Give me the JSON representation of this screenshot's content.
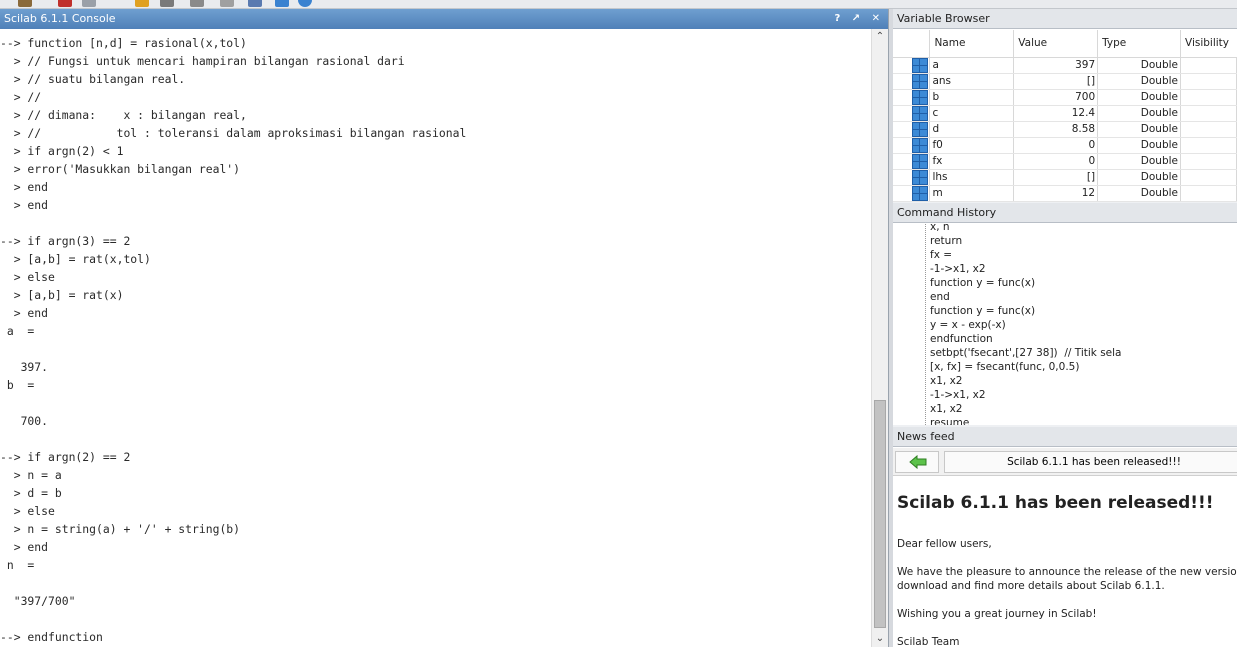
{
  "console": {
    "title": "Scilab 6.1.1 Console",
    "title_buttons": "? ↗ ✕",
    "lines": [
      "--> function [n,d] = rasional(x,tol)",
      "  > // Fungsi untuk mencari hampiran bilangan rasional dari",
      "  > // suatu bilangan real.",
      "  > //",
      "  > // dimana:    x : bilangan real,",
      "  > //           tol : toleransi dalam aproksimasi bilangan rasional",
      "  > if argn(2) < 1",
      "  > error('Masukkan bilangan real')",
      "  > end",
      "  > end",
      "",
      "--> if argn(3) == 2",
      "  > [a,b] = rat(x,tol)",
      "  > else",
      "  > [a,b] = rat(x)",
      "  > end",
      " a  =",
      "",
      "   397.",
      " b  =",
      "",
      "   700.",
      "",
      "--> if argn(2) == 2",
      "  > n = a",
      "  > d = b",
      "  > else",
      "  > n = string(a) + '/' + string(b)",
      "  > end",
      " n  =",
      "",
      "  \"397/700\"",
      "",
      "--> endfunction"
    ]
  },
  "variable_browser": {
    "title": "Variable Browser",
    "columns": [
      "Name",
      "Value",
      "Type",
      "Visibility"
    ],
    "rows": [
      {
        "name": "a",
        "value": "397",
        "type": "Double"
      },
      {
        "name": "ans",
        "value": "[]",
        "type": "Double"
      },
      {
        "name": "b",
        "value": "700",
        "type": "Double"
      },
      {
        "name": "c",
        "value": "12.4",
        "type": "Double"
      },
      {
        "name": "d",
        "value": "8.58",
        "type": "Double"
      },
      {
        "name": "f0",
        "value": "0",
        "type": "Double"
      },
      {
        "name": "fx",
        "value": "0",
        "type": "Double"
      },
      {
        "name": "lhs",
        "value": "[]",
        "type": "Double"
      },
      {
        "name": "m",
        "value": "12",
        "type": "Double"
      }
    ]
  },
  "command_history": {
    "title": "Command History",
    "items": [
      "x, n",
      "return",
      "fx =",
      "-1->x1, x2",
      "function y = func(x)",
      "end",
      "function y = func(x)",
      "y = x - exp(-x)",
      "endfunction",
      "setbpt('fsecant',[27 38])  // Titik sela",
      "[x, fx] = fsecant(func, 0,0.5)",
      "x1, x2",
      "-1->x1, x2",
      "x1, x2",
      "resume"
    ]
  },
  "news_feed": {
    "title": "News feed",
    "headline_button": "Scilab 6.1.1 has been released!!!",
    "heading": "Scilab 6.1.1 has been released!!!",
    "greeting": "Dear fellow users,",
    "paragraph_line1": "We have the pleasure to announce the release of the new version of S",
    "paragraph_line2": "download and find more details about Scilab 6.1.1.",
    "wish": "Wishing you a great journey in Scilab!",
    "signature": "Scilab Team"
  }
}
